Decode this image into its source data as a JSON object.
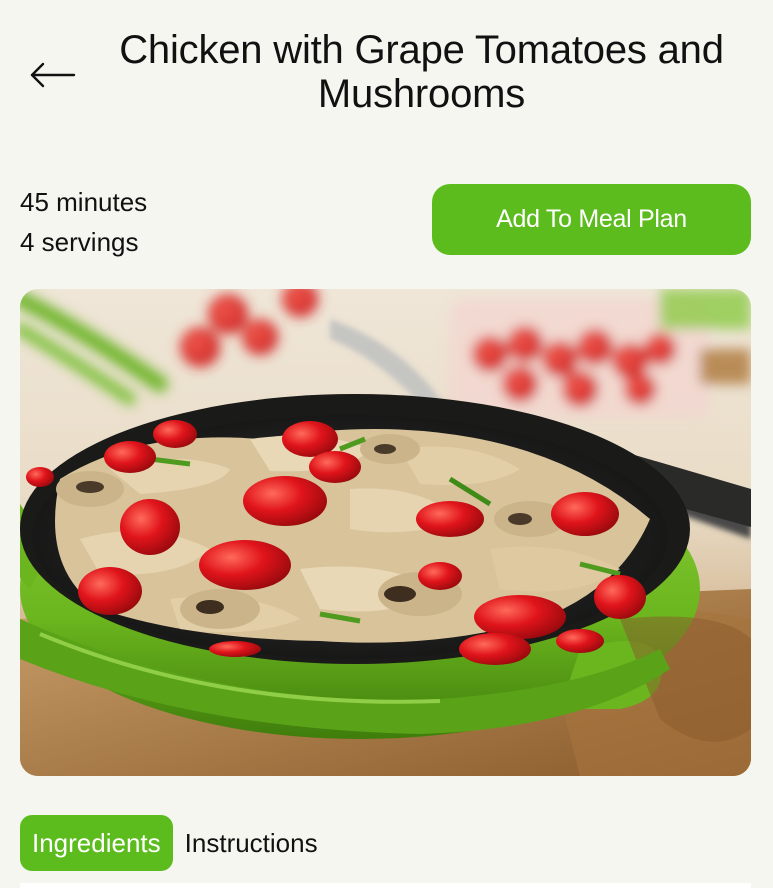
{
  "header": {
    "back_icon": "left-arrow-icon",
    "title": "Chicken with Grape Tomatoes and Mushrooms"
  },
  "recipe": {
    "time": "45 minutes",
    "servings": "4 servings",
    "add_button_label": "Add To Meal Plan",
    "image_subject": "skillet of chicken with grape tomatoes and mushrooms"
  },
  "tabs": [
    {
      "label": "Ingredients",
      "active": true
    },
    {
      "label": "Instructions",
      "active": false
    }
  ],
  "colors": {
    "accent": "#5cbc1e",
    "background": "#f6f6f1",
    "text": "#111111"
  }
}
